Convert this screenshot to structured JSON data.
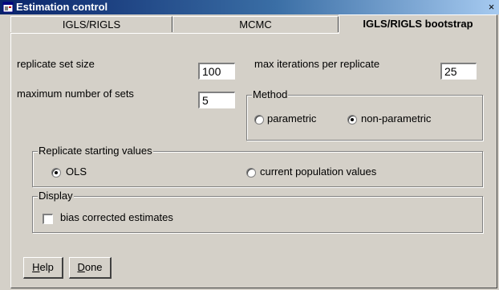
{
  "window": {
    "title": "Estimation control",
    "close_glyph": "×"
  },
  "tabs": [
    {
      "label": "IGLS/RIGLS",
      "active": false
    },
    {
      "label": "MCMC",
      "active": false
    },
    {
      "label": "IGLS/RIGLS bootstrap",
      "active": true
    }
  ],
  "fields": {
    "replicate_set_size": {
      "label": "replicate set size",
      "value": "100"
    },
    "max_iterations": {
      "label": "max iterations per replicate",
      "value": "25"
    },
    "max_sets": {
      "label": "maximum number of sets",
      "value": "5"
    }
  },
  "method": {
    "legend": "Method",
    "options": [
      {
        "label": "parametric",
        "selected": false
      },
      {
        "label": "non-parametric",
        "selected": true
      }
    ]
  },
  "replicate_start": {
    "legend": "Replicate starting values",
    "options": [
      {
        "label": "OLS",
        "selected": true
      },
      {
        "label": "current population values",
        "selected": false
      }
    ]
  },
  "display": {
    "legend": "Display",
    "checkbox": {
      "label": "bias corrected estimates",
      "checked": false
    }
  },
  "buttons": {
    "help": {
      "accel": "H",
      "rest": "elp"
    },
    "done": {
      "accel": "D",
      "rest": "one"
    }
  },
  "icons": {
    "title": "app-window-icon",
    "close": "close-icon"
  },
  "colors": {
    "titlebar_start": "#0a246a",
    "titlebar_end": "#a6caf0",
    "face": "#d4d0c8"
  }
}
